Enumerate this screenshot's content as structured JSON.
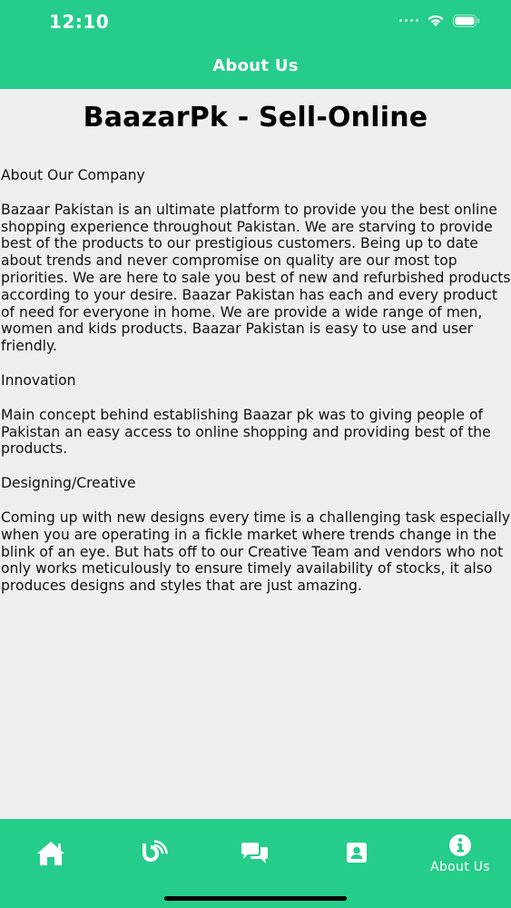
{
  "status_bar": {
    "time": "12:10"
  },
  "header": {
    "title": "About Us"
  },
  "content": {
    "company_title": "BaazarPk - Sell-Online",
    "sections": [
      {
        "heading": "About Our Company",
        "body": "Bazaar Pakistan is an ultimate platform to provide you the best online shopping experience throughout Pakistan. We are starving to provide best of the products to our prestigious customers. Being up to date about trends and never compromise on quality are our most top priorities. We are here to sale you best of new and refurbished products according to your desire. Baazar Pakistan has each and every product of need for everyone in home. We are provide a wide range of men, women and kids products. Baazar Pakistan is easy to use and user friendly."
      },
      {
        "heading": "Innovation",
        "body": "Main concept behind establishing Baazar pk was to giving people of Pakistan an easy access to online shopping and providing best of the products."
      },
      {
        "heading": "Designing/Creative",
        "body": "Coming up with new designs every time is a challenging task especially when you are operating in a fickle market where trends change in the blink of an eye. But hats off to our Creative Team and vendors who not only works meticulously to ensure timely availability of stocks, it also produces designs and styles that are just amazing."
      }
    ]
  },
  "tabbar": {
    "tabs": [
      {
        "icon": "home-icon",
        "label": ""
      },
      {
        "icon": "blog-icon",
        "label": ""
      },
      {
        "icon": "chat-icon",
        "label": ""
      },
      {
        "icon": "contact-icon",
        "label": ""
      },
      {
        "icon": "info-icon",
        "label": "About Us"
      }
    ]
  },
  "colors": {
    "brand": "#25cc8a",
    "background": "#efefef"
  }
}
